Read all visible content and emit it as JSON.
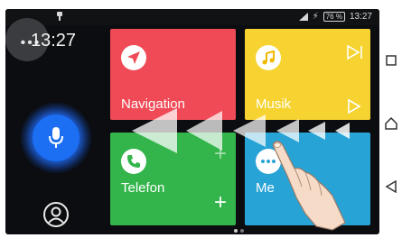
{
  "status_bar": {
    "battery": "76 %",
    "time": "13:27"
  },
  "left_panel": {
    "clock": "13:27",
    "menu_glyph": "•••"
  },
  "tiles": {
    "navigation": {
      "label": "Navigation",
      "color": "#ef4a55"
    },
    "music": {
      "label": "Musik",
      "color": "#f6d330"
    },
    "phone": {
      "label": "Telefon",
      "color": "#33b54b"
    },
    "more": {
      "label": "Me",
      "color": "#27a3d6"
    }
  },
  "icons": {
    "mic": "microphone-icon",
    "profile": "profile-icon",
    "nav": "navigation-arrow-icon",
    "music": "music-note-icon",
    "phone": "phone-icon",
    "more": "more-dots-icon",
    "swipe_hand": "pointing-hand-icon"
  },
  "accent": "#1c6ef2"
}
